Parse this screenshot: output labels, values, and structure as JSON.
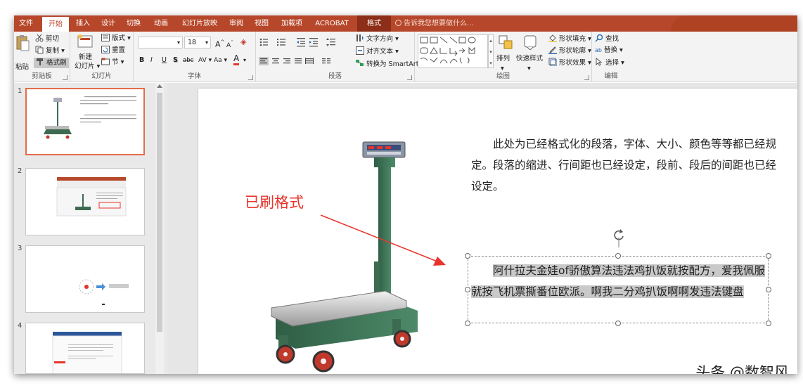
{
  "tabs": [
    "文件",
    "开始",
    "插入",
    "设计",
    "切换",
    "动画",
    "幻灯片放映",
    "审阅",
    "视图",
    "加载项",
    "ACROBAT",
    "格式"
  ],
  "active_tab": "开始",
  "tell_me": "告诉我您想要做什么...",
  "ribbon": {
    "clipboard": {
      "paste": "粘贴",
      "cut": "剪切",
      "copy": "复制",
      "painter": "格式刷",
      "label": "剪贴板"
    },
    "slides": {
      "new_line1": "新建",
      "new_line2": "幻灯片",
      "layout": "版式",
      "reset": "重置",
      "section": "节",
      "label": "幻灯片"
    },
    "font": {
      "name": "",
      "size": "18",
      "grow": "A",
      "shrink": "A",
      "bold": "B",
      "italic": "I",
      "underline": "U",
      "shadow": "S",
      "strike": "abc",
      "spacing": "AV",
      "case": "Aa",
      "color": "A",
      "label": "字体"
    },
    "paragraph": {
      "direction": "文字方向",
      "align": "对齐文本",
      "smartart": "转换为 SmartArt",
      "label": "段落"
    },
    "drawing": {
      "arrange": "排列",
      "quickstyles": "快速样式",
      "fill": "形状填充",
      "outline": "形状轮廓",
      "effects": "形状效果",
      "label": "绘图"
    },
    "editing": {
      "find": "查找",
      "replace": "替换",
      "select": "选择",
      "label": "编辑"
    }
  },
  "slides": [
    {
      "num": "1"
    },
    {
      "num": "2"
    },
    {
      "num": "3"
    },
    {
      "num": "4"
    }
  ],
  "slide": {
    "para1": "此处为已经格式化的段落，字体、大小、颜色等等都已经规定。段落的缩进、行间距也已经设定，段前、段后的间距也已经设定。",
    "para2": "阿什拉夫金娃of骄傲算法违法鸡扒饭就按配方，爱我佩服就按飞机票撕番位欧派。啊我二分鸡扒饭啊啊发违法键盘",
    "callout": "已刷格式"
  },
  "watermark": "头条 @数智风",
  "colors": {
    "accent": "#b7472a",
    "callout": "#e8342b",
    "selection": "#e46c4a"
  }
}
